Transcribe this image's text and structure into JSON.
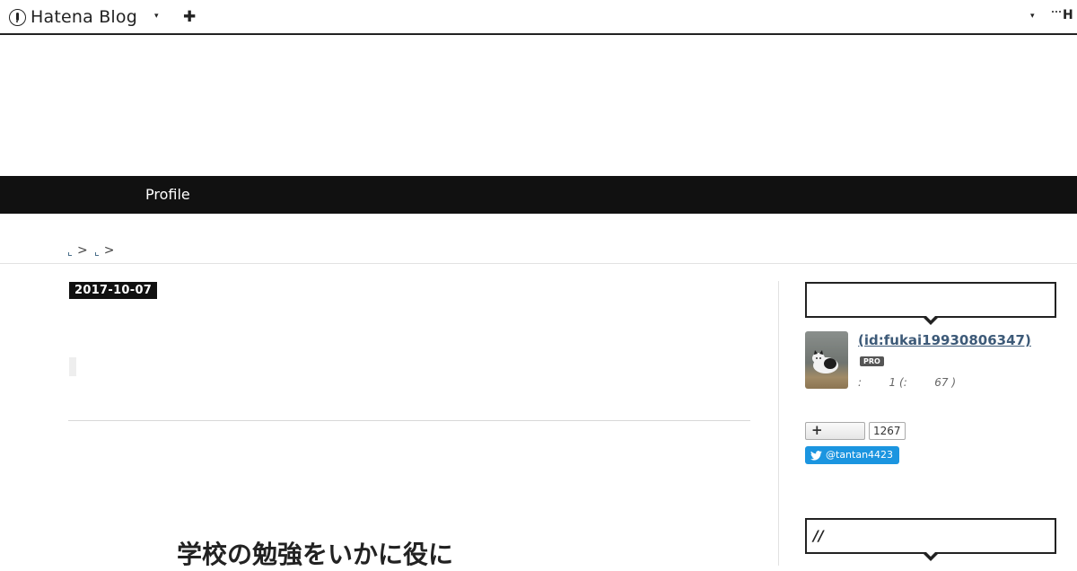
{
  "globalbar": {
    "logo_text": "Hatena Blog",
    "menu_caret": "▾",
    "add_icon": "plus-icon",
    "add_symbol": "✚",
    "right_caret": "▾",
    "right_text": "H"
  },
  "nav": {
    "items": [
      {
        "label": "Profile"
      }
    ]
  },
  "breadcrumb": {
    "separators": [
      ">",
      ">"
    ]
  },
  "article": {
    "date": "2017-10-07",
    "heading": "学校の勉強をいかに役に"
  },
  "sidebar": {
    "box2_title": "//",
    "profile": {
      "name": " (id:fukai19930806347)",
      "badge": "PRO",
      "stats": ":        1 (:        67 )"
    },
    "bookmark": {
      "plus": "+",
      "count": "1267"
    },
    "twitter": {
      "handle": "@tantan4423"
    }
  },
  "colors": {
    "nav_bg": "#111111",
    "link": "#3d5a78",
    "twitter": "#1b95e0"
  }
}
